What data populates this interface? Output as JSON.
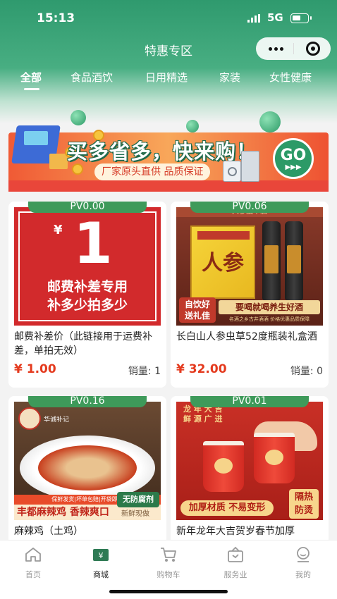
{
  "status_bar": {
    "time": "15:13",
    "network": "5G"
  },
  "header": {
    "title": "特惠专区"
  },
  "tabs": [
    {
      "label": "全部",
      "active": true
    },
    {
      "label": "食品酒饮",
      "active": false
    },
    {
      "label": "日用精选",
      "active": false
    },
    {
      "label": "家装",
      "active": false
    },
    {
      "label": "女性健康",
      "active": false
    }
  ],
  "banner": {
    "headline": "买多省多，快来购！",
    "slogan": "厂家原头直供 品质保证",
    "go_label": "GO",
    "go_arrows": "▶▶▶"
  },
  "products": [
    {
      "pv": "PV0.00",
      "name": "邮费补差价（此链接用于运费补差，单拍无效）",
      "price": "¥ 1.00",
      "sales": "销量: 1",
      "image_text": {
        "yen": "¥",
        "big": "1",
        "line1": "邮费补差专用",
        "line2": "补多少拍多少"
      }
    },
    {
      "pv": "PV0.06",
      "name": "长白山人参虫草52度瓶装礼盒酒",
      "price": "¥ 32.00",
      "sales": "销量: 0",
      "image_text": {
        "top": "人参虫草酒",
        "box": "人参",
        "badge1": "自饮好",
        "badge2": "送礼佳",
        "slogan": "要喝就喝养生好酒",
        "small": "名酒之乡古井酒酒 价格优惠品质保障"
      }
    },
    {
      "pv": "PV0.16",
      "name": "麻辣鸡（土鸡）",
      "price": "",
      "sales": "",
      "image_text": {
        "logo": "华诚补记",
        "strip": "保鲜发货|坏单包赔|开袋即食",
        "title": "丰都麻辣鸡 香辣爽口",
        "noadd": "无防腐剂",
        "fresh": "新鲜现做"
      }
    },
    {
      "pv": "PV0.01",
      "name": "新年龙年大吉贺岁春节加厚",
      "price": "",
      "sales": "",
      "image_text": {
        "head1": "龙 年 大 吉",
        "head2": "鲜 源 广 进",
        "tag1": "加厚材质 不易变形",
        "tag2a": "隔热",
        "tag2b": "防烫"
      }
    }
  ],
  "tabbar": [
    {
      "label": "首页",
      "icon": "home-icon",
      "active": false
    },
    {
      "label": "商城",
      "icon": "mall-icon",
      "active": true
    },
    {
      "label": "购物车",
      "icon": "cart-icon",
      "active": false
    },
    {
      "label": "服务业",
      "icon": "service-icon",
      "active": false
    },
    {
      "label": "我的",
      "icon": "profile-icon",
      "active": false
    }
  ],
  "colors": {
    "brand_green": "#2f9a6e",
    "price_red": "#e43a1e",
    "pv_green": "#3e9a5a"
  }
}
